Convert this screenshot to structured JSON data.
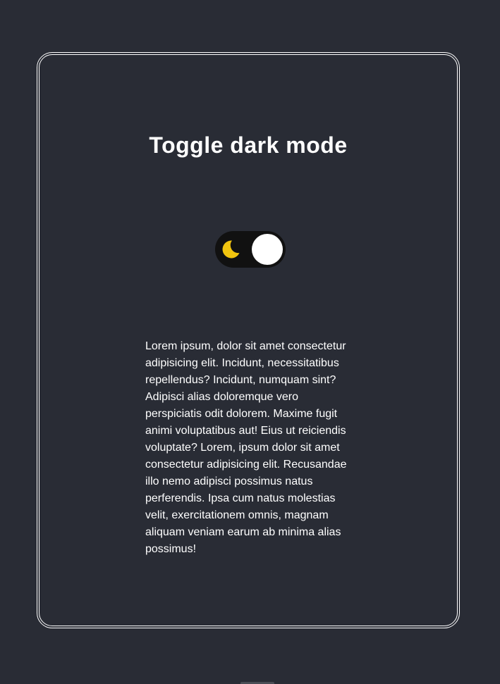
{
  "theme": {
    "background": "#292c35",
    "toggle_track": "#111111",
    "moon_color": "#f1c40f",
    "knob_color": "#ffffff",
    "text_color": "#ffffff"
  },
  "card": {
    "title": "Toggle dark mode",
    "toggle": {
      "state": "dark",
      "icon": "moon-icon"
    },
    "paragraph": "Lorem ipsum, dolor sit amet consectetur adipisicing elit. Incidunt, necessitatibus repellendus? Incidunt, numquam sint? Adipisci alias doloremque vero perspiciatis odit dolorem. Maxime fugit animi voluptatibus aut! Eius ut reiciendis voluptate? Lorem, ipsum dolor sit amet consectetur adipisicing elit. Recusandae illo nemo adipisci possimus natus perferendis. Ipsa cum natus molestias velit, exercitationem omnis, magnam aliquam veniam earum ab minima alias possimus!"
  }
}
